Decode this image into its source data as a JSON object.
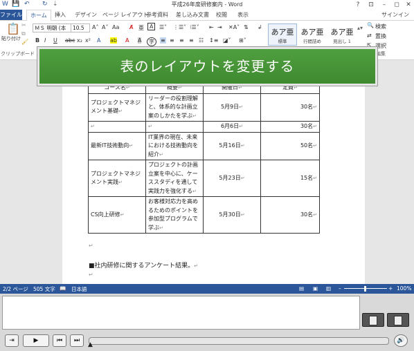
{
  "window": {
    "title": "平成26年度研修案内 - Word",
    "controls": [
      "?",
      "⊡",
      "–",
      "◻",
      "✕"
    ],
    "signin": "サインイン"
  },
  "ribbon": {
    "tabs": [
      "ファイル",
      "ホーム",
      "挿入",
      "デザイン",
      "ページ レイアウト",
      "参考資料",
      "差し込み文書",
      "校閲",
      "表示"
    ],
    "font_name": "ＭＳ 明朝 (本",
    "font_size": "10.5",
    "paste_label": "貼り付け",
    "clipboard_label": "クリップボード",
    "styles": [
      {
        "sample": "あア亜",
        "name": "標準"
      },
      {
        "sample": "あア亜",
        "name": "行間詰め"
      },
      {
        "sample": "あア亜",
        "name": "見出し 1"
      }
    ],
    "edit": {
      "find": "検索",
      "replace": "置換",
      "select": "選択",
      "group": "編集"
    }
  },
  "banner": {
    "text": "表のレイアウトを変更する"
  },
  "table": {
    "headers": [
      "コース名",
      "概要",
      "開催日",
      "定員"
    ],
    "rows": [
      {
        "name": "プロジェクトマネジメント基礎",
        "summary": "リーダーの役割理解と、体系的な計画立案のしかたを学ぶ",
        "date": "5月9日",
        "cap": "30名"
      },
      {
        "name": "",
        "summary": "",
        "date": "6月6日",
        "cap": "30名"
      },
      {
        "name": "最新IT技術動向",
        "summary": "IT業界の現在、未来における技術動向を紹介",
        "date": "5月16日",
        "cap": "50名"
      },
      {
        "name": "プロジェクトマネジメント実践",
        "summary": "プロジェクトの計画立案を中心に、ケーススタディを通して実践力を強化する",
        "date": "5月23日",
        "cap": "15名"
      },
      {
        "name": "CS向上研修",
        "summary": "お客様対応力を高めるためのポイントを参加型プログラムで学ぶ",
        "date": "5月30日",
        "cap": "30名"
      }
    ]
  },
  "body_text": {
    "notice": "■社内研修に関するアンケート結果。"
  },
  "status": {
    "page": "2/2 ページ",
    "words": "505 文字",
    "lang": "日本語",
    "zoom": "100%"
  }
}
